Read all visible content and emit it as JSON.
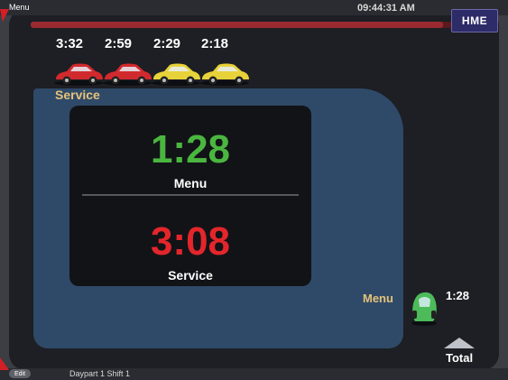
{
  "top_bar": {
    "menu_label": "Menu",
    "clock": "09:44:31 AM"
  },
  "logo": {
    "text": "HME"
  },
  "progress": {
    "fraction": 0.96,
    "fill_color": "#9b2a30"
  },
  "cars": [
    {
      "time": "3:32",
      "color": "#d12a2e"
    },
    {
      "time": "2:59",
      "color": "#d12a2e"
    },
    {
      "time": "2:29",
      "color": "#e8d23a"
    },
    {
      "time": "2:18",
      "color": "#e8d23a"
    }
  ],
  "section_label": "Service",
  "timers": {
    "menu": {
      "time": "1:28",
      "label": "Menu",
      "color": "#4ab63f"
    },
    "service": {
      "time": "3:08",
      "label": "Service",
      "color": "#e3262b"
    }
  },
  "menu_lane": {
    "label": "Menu",
    "time": "1:28",
    "car_color": "#4dbb5a"
  },
  "total": {
    "label": "Total"
  },
  "bottom_bar": {
    "edit_label": "Edit",
    "daypart": "Daypart 1 Shift 1"
  }
}
